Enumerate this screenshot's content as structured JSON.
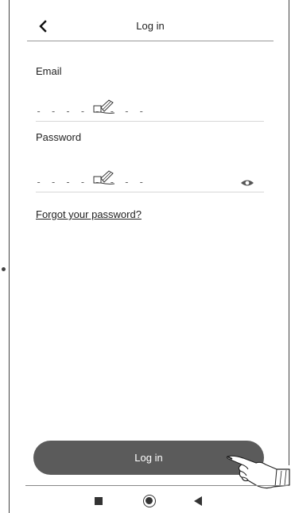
{
  "header": {
    "title": "Log in",
    "back_icon": "chevron-left-icon"
  },
  "form": {
    "email": {
      "label": "Email",
      "value": "- - - - - - - -",
      "icon": "handwriting-pen-icon"
    },
    "password": {
      "label": "Password",
      "value": "- - - - - - - -",
      "icon": "handwriting-pen-icon",
      "visibility_icon": "eye-icon"
    },
    "forgot_link": "Forgot your password?"
  },
  "actions": {
    "login_label": "Log in",
    "pointer_icon": "hand-pointer-icon"
  },
  "system_nav": {
    "recents_icon": "square-icon",
    "home_icon": "circle-icon",
    "back_icon": "triangle-back-icon"
  }
}
